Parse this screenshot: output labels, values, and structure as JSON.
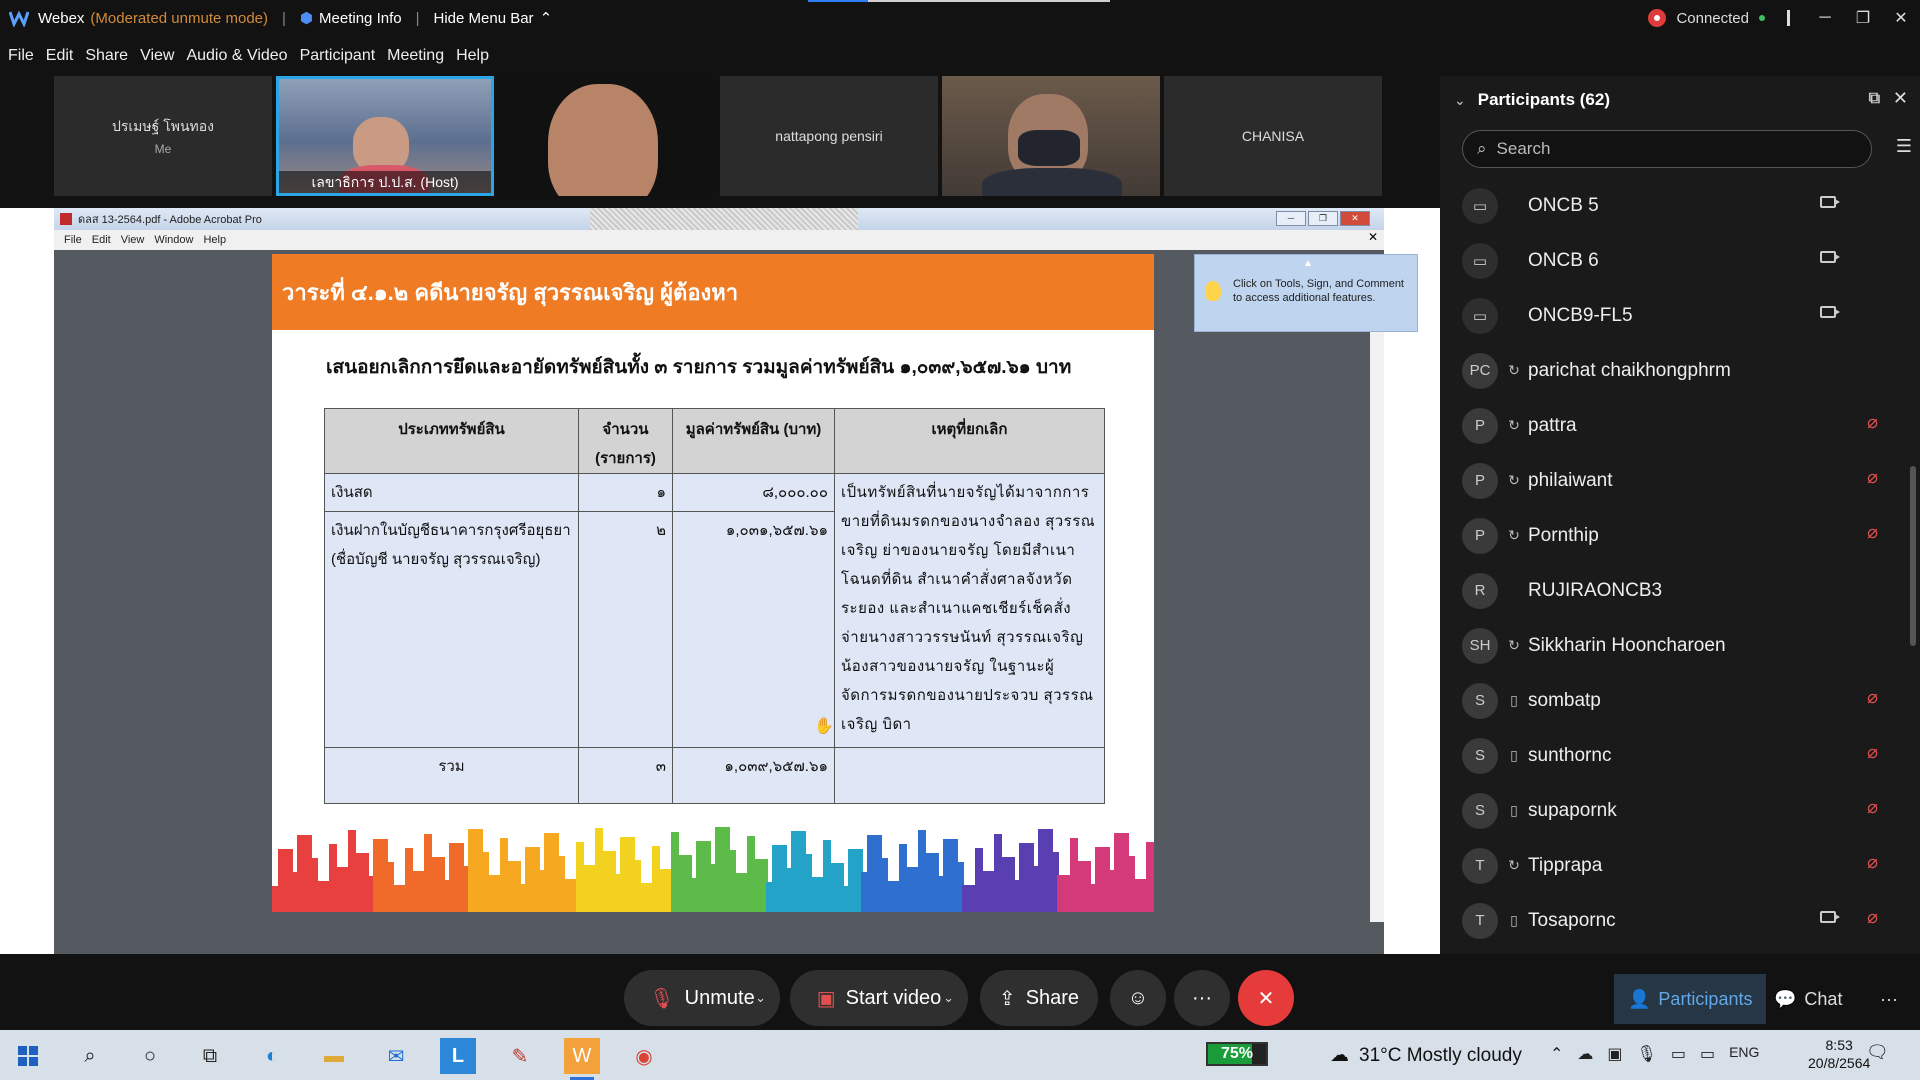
{
  "titlebar": {
    "app": "Webex",
    "mode": "(Moderated unmute mode)",
    "meeting_info": "Meeting Info",
    "hide_menu": "Hide Menu Bar",
    "status": "Connected"
  },
  "menu": [
    "File",
    "Edit",
    "Share",
    "View",
    "Audio & Video",
    "Participant",
    "Meeting",
    "Help"
  ],
  "thumbnails": [
    {
      "name": "ปรเมษฐ์ โพนทอง",
      "sub": "Me"
    },
    {
      "name": "เลขาธิการ ป.ป.ส. (Host)"
    },
    {
      "name": ""
    },
    {
      "name": "nattapong pensiri"
    },
    {
      "name": ""
    },
    {
      "name": "CHANISA"
    }
  ],
  "acrobat": {
    "title": "ดลส 13-2564.pdf - Adobe Acrobat Pro",
    "menu": [
      "File",
      "Edit",
      "View",
      "Window",
      "Help"
    ],
    "tip": "Click on Tools, Sign, and Comment to access additional features."
  },
  "slide": {
    "heading": "วาระที่ ๔.๑.๒ คดีนายจรัญ สุวรรณเจริญ ผู้ต้องหา",
    "subheading": "เสนอยกเลิกการยึดและอายัดทรัพย์สินทั้ง ๓ รายการ รวมมูลค่าทรัพย์สิน ๑,๐๓๙,๖๕๗.๖๑ บาท",
    "columns": [
      "ประเภททรัพย์สิน",
      "จำนวน (รายการ)",
      "มูลค่าทรัพย์สิน (บาท)",
      "เหตุที่ยกเลิก"
    ],
    "row1": {
      "type": "เงินสด",
      "qty": "๑",
      "value": "๘,๐๐๐.๐๐"
    },
    "row2": {
      "type": "เงินฝากในบัญชีธนาคารกรุงศรีอยุธยา (ชื่อบัญชี นายจรัญ สุวรรณเจริญ)",
      "qty": "๒",
      "value": "๑,๐๓๑,๖๕๗.๖๑"
    },
    "reason": "เป็นทรัพย์สินที่นายจรัญได้มาจากการขายที่ดินมรดกของนางจำลอง สุวรรณเจริญ ย่าของนายจรัญ โดยมีสำเนาโฉนดที่ดิน สำเนาคำสั่งศาลจังหวัดระยอง และสำเนาแคชเชียร์เช็คสั่งจ่ายนางสาววรรษนันท์ สุวรรณเจริญ น้องสาวของนายจรัญ ในฐานะผู้จัดการมรดกของนายประจวบ สุวรรณเจริญ บิดา",
    "total": {
      "label": "รวม",
      "qty": "๓",
      "value": "๑,๐๓๙,๖๕๗.๖๑"
    }
  },
  "participants": {
    "title": "Participants (62)",
    "search_placeholder": "Search",
    "list": [
      {
        "initials": "",
        "name": "ONCB 5",
        "device": "room",
        "video": true,
        "muted": false
      },
      {
        "initials": "",
        "name": "ONCB 6",
        "device": "room",
        "video": true,
        "muted": false
      },
      {
        "initials": "",
        "name": "ONCB9-FL5",
        "device": "room",
        "video": true,
        "muted": false
      },
      {
        "initials": "PC",
        "name": "parichat chaikhongphrm",
        "device": "sync",
        "video": false,
        "muted": false
      },
      {
        "initials": "P",
        "name": "pattra",
        "device": "sync",
        "video": false,
        "muted": true
      },
      {
        "initials": "P",
        "name": "philaiwant",
        "device": "sync",
        "video": false,
        "muted": true
      },
      {
        "initials": "P",
        "name": "Pornthip",
        "device": "sync",
        "video": false,
        "muted": true
      },
      {
        "initials": "R",
        "name": "RUJIRAONCB3",
        "device": "",
        "video": false,
        "muted": false
      },
      {
        "initials": "SH",
        "name": "Sikkharin Hooncharoen",
        "device": "sync",
        "video": false,
        "muted": false
      },
      {
        "initials": "S",
        "name": "sombatp",
        "device": "mobile",
        "video": false,
        "muted": true
      },
      {
        "initials": "S",
        "name": "sunthornc",
        "device": "mobile",
        "video": false,
        "muted": true
      },
      {
        "initials": "S",
        "name": "supapornk",
        "device": "mobile",
        "video": false,
        "muted": true
      },
      {
        "initials": "T",
        "name": "Tipprapa",
        "device": "sync",
        "video": false,
        "muted": true
      },
      {
        "initials": "T",
        "name": "Tosapornc",
        "device": "mobile",
        "video": true,
        "muted": true
      }
    ]
  },
  "controls": {
    "unmute": "Unmute",
    "start_video": "Start video",
    "share": "Share",
    "participants": "Participants",
    "chat": "Chat"
  },
  "taskbar": {
    "battery": "75%",
    "battery_level": 0.75,
    "weather": "31°C  Mostly cloudy",
    "lang": "ENG",
    "time": "8:53",
    "date": "20/8/2564"
  }
}
